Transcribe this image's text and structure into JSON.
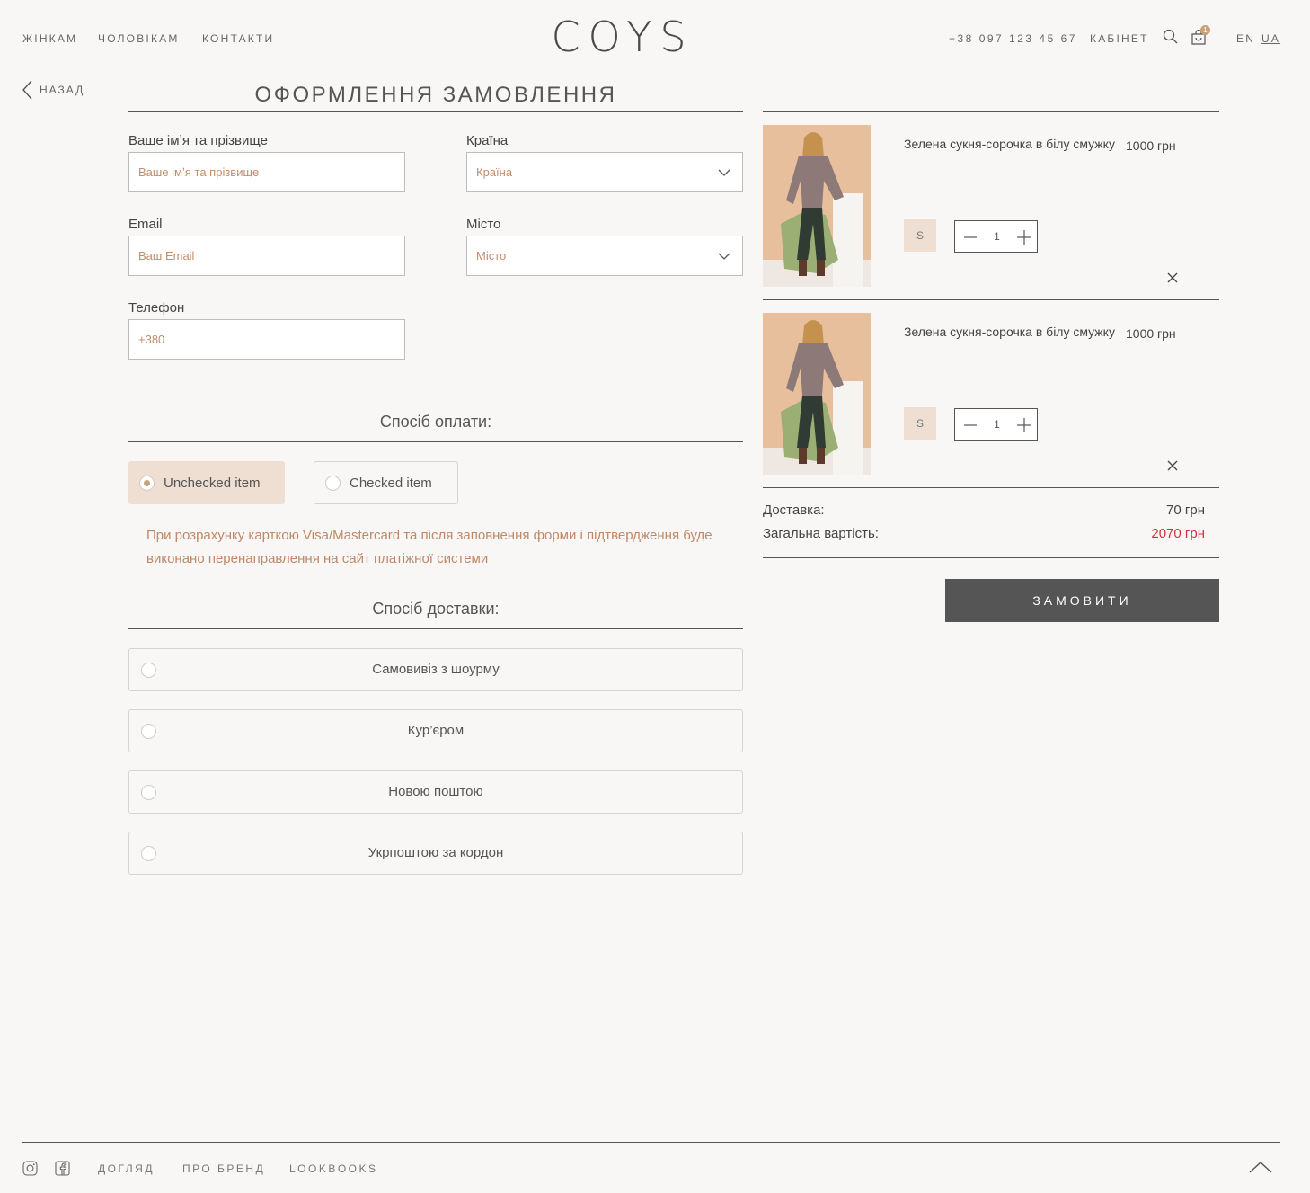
{
  "header": {
    "nav": [
      "ЖІНКАМ",
      "ЧОЛОВІКАМ",
      "КОНТАКТИ"
    ],
    "logo": "COYS",
    "phone": "+38 097 123 45 67",
    "cabinet": "КАБІНЕТ",
    "cart_count": "1",
    "lang_en": "EN",
    "lang_ua": "UA"
  },
  "back_label": "НАЗАД",
  "page_title": "ОФОРМЛЕННЯ ЗАМОВЛЕННЯ",
  "form": {
    "name_label": "Ваше імʼя та прізвище",
    "name_placeholder": "Ваше імʼя та прізвище",
    "country_label": "Країна",
    "country_value": "Країна",
    "email_label": "Email",
    "email_placeholder": "Ваш Email",
    "city_label": "Місто",
    "city_value": "Місто",
    "phone_label": "Телефон",
    "phone_placeholder": "+380"
  },
  "payment": {
    "title": "Спосіб оплати:",
    "options": [
      "Unchecked item",
      "Checked item"
    ],
    "note": "При розрахунку карткою Visa/Mastercard та після заповнення форми і підтвердження буде виконано перенаправлення на сайт платіжної системи"
  },
  "delivery": {
    "title": "Спосіб доставки:",
    "options": [
      "Самовивіз з шоурму",
      "Кур’єром",
      "Новою поштою",
      "Укрпоштою за кордон"
    ]
  },
  "cart": {
    "items": [
      {
        "name": "Зелена сукня-сорочка в білу смужку",
        "price": "1000 грн",
        "size": "S",
        "qty": "1"
      },
      {
        "name": "Зелена сукня-сорочка в білу смужку",
        "price": "1000 грн",
        "size": "S",
        "qty": "1"
      }
    ],
    "delivery_label": "Доставка:",
    "delivery_value": "70 грн",
    "total_label": "Загальна вартість:",
    "total_value": "2070 грн",
    "order_button": "ЗАМОВИТИ"
  },
  "footer": {
    "links": [
      "ДОГЛЯД",
      "ПРО БРЕНД",
      "LOOKBOOKS"
    ]
  },
  "colors": {
    "background": "#f8f7f5",
    "accent": "#c9a07a",
    "note_text": "#c08868",
    "total_red": "#d0343a",
    "button": "#555555",
    "selected_option": "#efdfd2"
  },
  "icons": [
    "instagram-icon",
    "facebook-icon",
    "search-icon",
    "cart-icon",
    "chevron-down-icon",
    "close-icon",
    "arrow-up-icon",
    "chevron-left-icon"
  ]
}
